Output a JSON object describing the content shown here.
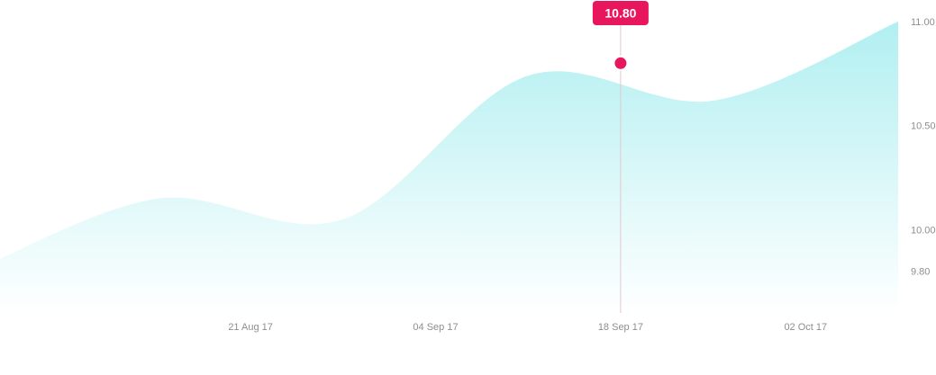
{
  "chart_data": {
    "type": "area",
    "title": "",
    "xlabel": "",
    "ylabel": "",
    "x": [
      "2017-07-31",
      "2017-08-14",
      "2017-08-28",
      "2017-09-11",
      "2017-09-25",
      "2017-10-09"
    ],
    "series": [
      {
        "values": [
          9.8,
          10.15,
          10.05,
          10.74,
          10.62,
          11.0
        ]
      }
    ],
    "x_ticks": [
      "21 Aug 17",
      "04 Sep 17",
      "18 Sep 17",
      "02 Oct 17"
    ],
    "y_ticks": [
      "9.80",
      "10.00",
      "10.50",
      "11.00"
    ],
    "ylim": [
      9.6,
      11.0
    ],
    "grid": false,
    "legend": "none",
    "highlight": {
      "x": "18 Sep 17",
      "value": 10.8,
      "label": "10.80"
    },
    "colors": {
      "area_top": "#b1eff1",
      "area_bottom": "#ffffff",
      "marker": "#e8175d",
      "tooltip_bg": "#e8175d",
      "crosshair": "#e0c8d0",
      "tick_text": "#8e8e8e"
    }
  }
}
